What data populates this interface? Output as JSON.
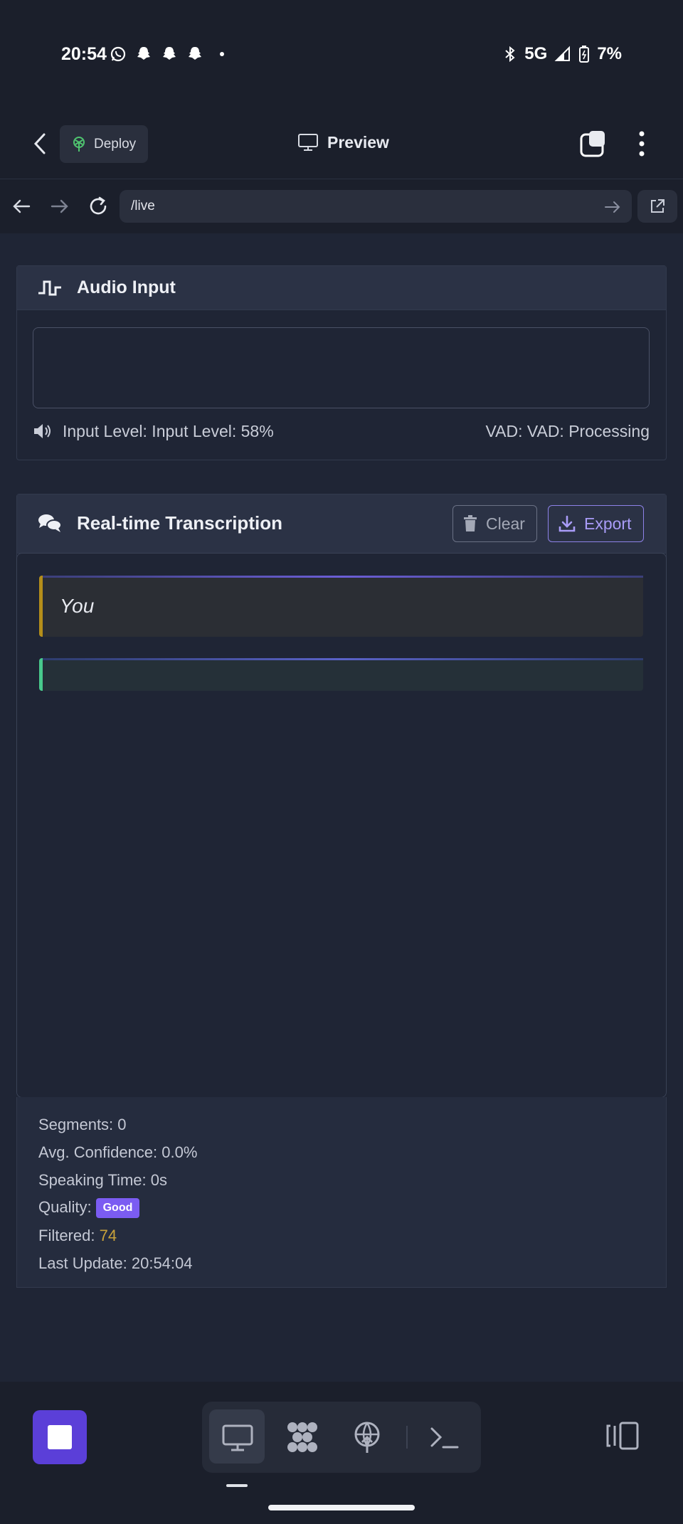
{
  "status_bar": {
    "time": "20:54",
    "network": "5G",
    "battery": "7%",
    "icons": [
      "whatsapp-icon",
      "snapchat-icon",
      "snapchat-icon",
      "snapchat-icon",
      "dot-icon",
      "bluetooth-icon",
      "signal-icon",
      "battery-icon"
    ]
  },
  "header": {
    "deploy_label": "Deploy",
    "preview_label": "Preview"
  },
  "browser": {
    "url": "/live"
  },
  "audio_input": {
    "title": "Audio Input",
    "input_level": "Input Level: Input Level: 58%",
    "vad": "VAD: VAD: Processing"
  },
  "transcription": {
    "title": "Real-time Transcription",
    "clear_label": "Clear",
    "export_label": "Export",
    "segments": [
      {
        "speaker": "You",
        "text": ""
      },
      {
        "speaker": "",
        "text": ""
      }
    ]
  },
  "stats": {
    "segments": "Segments: 0",
    "confidence": "Avg. Confidence: 0.0%",
    "speaking_time": "Speaking Time: 0s",
    "quality_label": "Quality:",
    "quality_value": "Good",
    "filtered_label": "Filtered:",
    "filtered_value": "74",
    "last_update": "Last Update: 20:54:04"
  },
  "colors": {
    "accent": "#7b5cf2",
    "stop_button": "#5b3fd8",
    "you_border": "#b48e1a",
    "ai_border": "#48c98c",
    "filtered": "#c9a23a"
  }
}
